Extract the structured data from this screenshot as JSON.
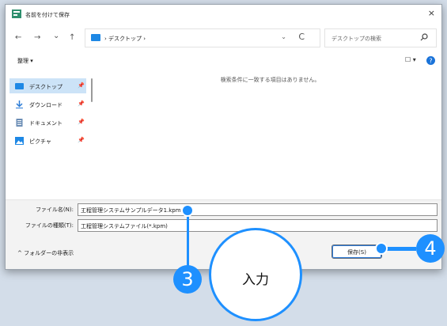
{
  "window": {
    "title": "名前を付けて保存",
    "close_glyph": "×"
  },
  "nav": {
    "back": "←",
    "forward": "→",
    "history": "⌄",
    "up": "↑",
    "address": "› デスクトップ ›",
    "address_dropdown": "⌄",
    "refresh": "C",
    "search_placeholder": "デスクトップの検索"
  },
  "toolbar": {
    "organize": "整理 ▾",
    "view": "☐ ▾"
  },
  "sidebar": {
    "items": [
      {
        "label": "デスクトップ",
        "icon": "desktop-icon"
      },
      {
        "label": "ダウンロード",
        "icon": "download-icon"
      },
      {
        "label": "ドキュメント",
        "icon": "document-icon"
      },
      {
        "label": "ピクチャ",
        "icon": "picture-icon"
      }
    ],
    "pin": "📌"
  },
  "content": {
    "empty_message": "検索条件に一致する項目はありません。"
  },
  "fields": {
    "filename_label": "ファイル名(N):",
    "filename_value": "工程管理システムサンプルデータ1.kpm",
    "filetype_label": "ファイルの種類(T):",
    "filetype_value": "工程管理システムファイル(*.kpm)"
  },
  "footer": {
    "hide_folders": "^ フォルダーの非表示",
    "save_label": "保存(S)"
  },
  "callouts": {
    "step3": "3",
    "step4": "4",
    "bubble_text": "入力"
  },
  "colors": {
    "accent": "#1e90ff",
    "selection": "#cce3f7"
  }
}
